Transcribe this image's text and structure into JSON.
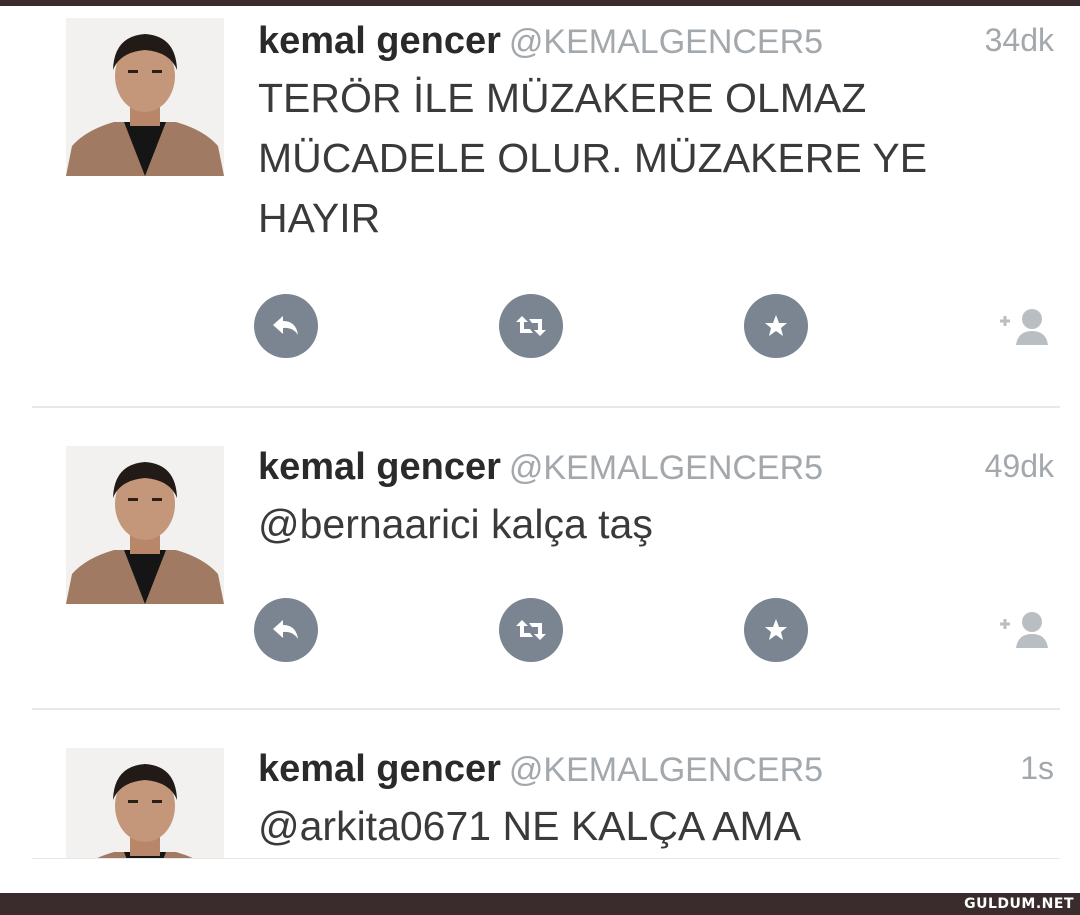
{
  "tweets": [
    {
      "name": "kemal gencer",
      "handle": "@KEMALGENCER5",
      "time": "34dk",
      "text": "TERÖR İLE MÜZAKERE OLMAZ\nMÜCADELE OLUR. MÜZAKERE YE\nHAYIR",
      "actions": [
        "reply-icon",
        "retweet-icon",
        "favorite-icon",
        "follow-icon"
      ]
    },
    {
      "name": "kemal gencer",
      "handle": "@KEMALGENCER5",
      "time": "49dk",
      "text": "@bernaarici kalça taş",
      "actions": [
        "reply-icon",
        "retweet-icon",
        "favorite-icon",
        "follow-icon"
      ]
    },
    {
      "name": "kemal gencer",
      "handle": "@KEMALGENCER5",
      "time": "1s",
      "text": "@arkita0671 NE KALÇA AMA"
    }
  ],
  "watermark": "GULDUM.NET",
  "colors": {
    "action_bg": "#7a8591",
    "handle": "#a3a8ad",
    "frame": "#3a2c2c"
  }
}
